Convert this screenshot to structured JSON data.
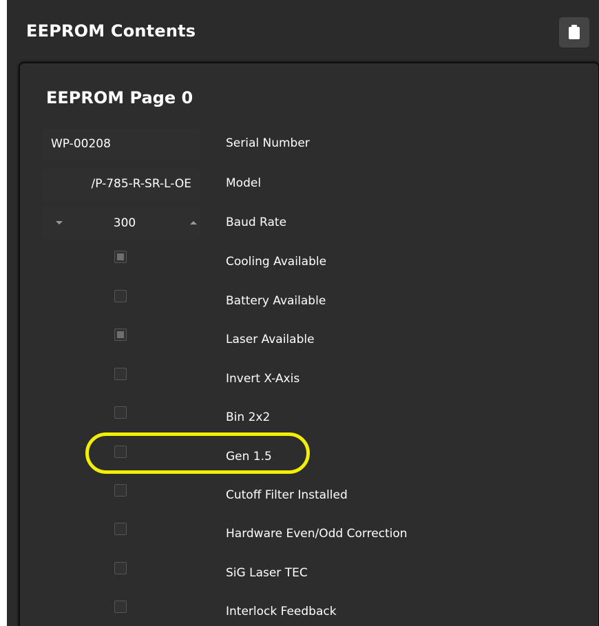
{
  "header": {
    "title": "EEPROM Contents",
    "clipboard_icon": "clipboard-icon"
  },
  "page": {
    "title": "EEPROM Page 0"
  },
  "serial_number": {
    "value": "WP-00208",
    "label": "Serial Number"
  },
  "model": {
    "value": "/P-785-R-SR-L-OE",
    "label": "Model"
  },
  "baud_rate": {
    "value": "300",
    "label": "Baud Rate"
  },
  "flags": [
    {
      "label": "Cooling Available",
      "checked": true
    },
    {
      "label": "Battery Available",
      "checked": false
    },
    {
      "label": "Laser Available",
      "checked": true
    },
    {
      "label": "Invert X-Axis",
      "checked": false
    },
    {
      "label": "Bin 2x2",
      "checked": false
    },
    {
      "label": "Gen 1.5",
      "checked": false
    },
    {
      "label": "Cutoff Filter Installed",
      "checked": false
    },
    {
      "label": "Hardware Even/Odd Correction",
      "checked": false
    },
    {
      "label": "SiG Laser TEC",
      "checked": false
    },
    {
      "label": "Interlock Feedback",
      "checked": false
    }
  ],
  "colors": {
    "background": "#2b2b2b",
    "text": "#ffffff",
    "highlight": "#f2ef00"
  }
}
